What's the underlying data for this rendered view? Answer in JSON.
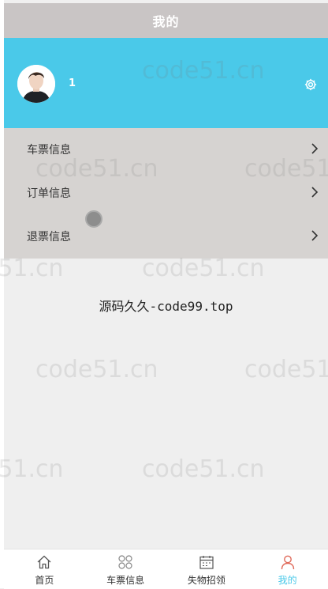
{
  "header": {
    "title": "我的"
  },
  "profile": {
    "username": "1",
    "avatar_icon": "user-avatar",
    "settings_icon": "gear-icon"
  },
  "menu": {
    "items": [
      {
        "label": "车票信息",
        "icon": "chevron-right-icon"
      },
      {
        "label": "订单信息",
        "icon": "chevron-right-icon"
      },
      {
        "label": "退票信息",
        "icon": "chevron-right-icon"
      }
    ]
  },
  "banner": {
    "text": "源码久久-code99.top"
  },
  "watermark": {
    "text": "code51.cn"
  },
  "tabbar": {
    "items": [
      {
        "label": "首页",
        "icon": "home-icon"
      },
      {
        "label": "车票信息",
        "icon": "grid-icon"
      },
      {
        "label": "失物招领",
        "icon": "calendar-icon"
      },
      {
        "label": "我的",
        "icon": "user-icon"
      }
    ],
    "active_index": 3
  },
  "colors": {
    "header_bg": "#c9c5c5",
    "profile_bg": "#4ac9e9",
    "menu_bg": "#d6d3d1",
    "accent": "#4ac9e9"
  }
}
